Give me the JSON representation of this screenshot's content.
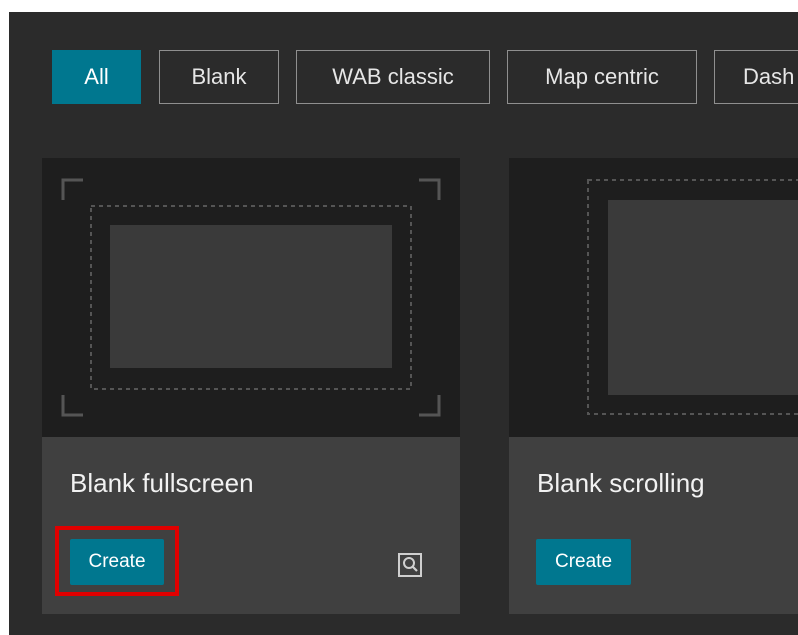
{
  "filters": {
    "items": [
      "All",
      "Blank",
      "WAB classic",
      "Map centric",
      "Dash"
    ],
    "active": "All"
  },
  "templates": [
    {
      "title": "Blank fullscreen",
      "create_label": "Create",
      "preview_icon": "preview-magnifier-icon"
    },
    {
      "title": "Blank scrolling",
      "create_label": "Create"
    }
  ],
  "colors": {
    "panel_background": "#2b2b2b",
    "card_background": "#404040",
    "thumbnail_background": "#1e1e1e",
    "accent": "#00778f",
    "highlight": "#e00000"
  }
}
